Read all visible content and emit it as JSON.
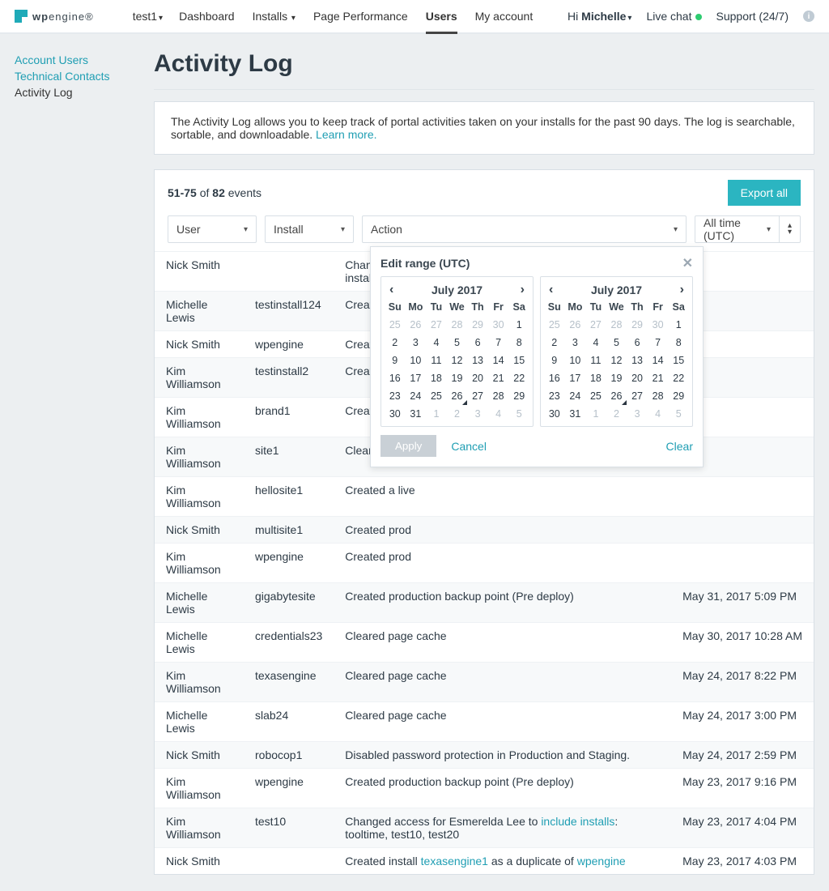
{
  "brand": {
    "name_strong": "wp",
    "name_light": "engine®"
  },
  "topnav": {
    "account": "test1",
    "items": [
      "Dashboard",
      "Installs",
      "Page Performance",
      "Users",
      "My account"
    ],
    "active_index": 3
  },
  "topright": {
    "hi_prefix": "Hi ",
    "user": "Michelle",
    "live_chat": "Live chat",
    "support": "Support (24/7)"
  },
  "sidebar": {
    "items": [
      "Account Users",
      "Technical Contacts",
      "Activity Log"
    ],
    "active_index": 2
  },
  "page": {
    "title": "Activity Log",
    "info_text": "The Activity Log allows you to keep track of portal activities taken on your installs for the past 90 days. The log is searchable, sortable, and downloadable. ",
    "learn_more": "Learn more."
  },
  "count": {
    "range": "51-75",
    "of_word": " of ",
    "total": "82",
    "tail": " events"
  },
  "export_label": "Export all",
  "filters": {
    "user": "User",
    "install": "Install",
    "action": "Action",
    "time": "All time (UTC)"
  },
  "popover": {
    "title": "Edit range (UTC)",
    "month": "July 2017",
    "dow": [
      "Su",
      "Mo",
      "Tu",
      "We",
      "Th",
      "Fr",
      "Sa"
    ],
    "cells": [
      {
        "n": 25,
        "m": true
      },
      {
        "n": 26,
        "m": true
      },
      {
        "n": 27,
        "m": true
      },
      {
        "n": 28,
        "m": true
      },
      {
        "n": 29,
        "m": true
      },
      {
        "n": 30,
        "m": true
      },
      {
        "n": 1
      },
      {
        "n": 2
      },
      {
        "n": 3
      },
      {
        "n": 4
      },
      {
        "n": 5
      },
      {
        "n": 6
      },
      {
        "n": 7
      },
      {
        "n": 8
      },
      {
        "n": 9
      },
      {
        "n": 10
      },
      {
        "n": 11
      },
      {
        "n": 12
      },
      {
        "n": 13
      },
      {
        "n": 14
      },
      {
        "n": 15
      },
      {
        "n": 16
      },
      {
        "n": 17
      },
      {
        "n": 18
      },
      {
        "n": 19
      },
      {
        "n": 20
      },
      {
        "n": 21
      },
      {
        "n": 22
      },
      {
        "n": 23
      },
      {
        "n": 24
      },
      {
        "n": 25
      },
      {
        "n": 26,
        "mark": true
      },
      {
        "n": 27
      },
      {
        "n": 28
      },
      {
        "n": 29
      },
      {
        "n": 30
      },
      {
        "n": 31
      },
      {
        "n": 1,
        "m": true
      },
      {
        "n": 2,
        "m": true
      },
      {
        "n": 3,
        "m": true
      },
      {
        "n": 4,
        "m": true
      },
      {
        "n": 5,
        "m": true
      }
    ],
    "apply": "Apply",
    "cancel": "Cancel",
    "clear": "Clear"
  },
  "rows": [
    {
      "user": "Nick Smith",
      "install": "",
      "action_pre": "Changed acc",
      "action_post": "install1, insta",
      "date": ""
    },
    {
      "user": "Michelle Lewis",
      "install": "testinstall124",
      "action": "Created insta",
      "date": ""
    },
    {
      "user": "Nick Smith",
      "install": "wpengine",
      "action": "Created prod",
      "date": ""
    },
    {
      "user": "Kim Williamson",
      "install": "testinstall2",
      "action": "Created a sta",
      "date": ""
    },
    {
      "user": "Kim Williamson",
      "install": "brand1",
      "action": "Created a sta",
      "date": ""
    },
    {
      "user": "Kim Williamson",
      "install": "site1",
      "action": "Cleared page",
      "date": ""
    },
    {
      "user": "Kim Williamson",
      "install": "hellosite1",
      "action": "Created a live",
      "date": ""
    },
    {
      "user": "Nick Smith",
      "install": "multisite1",
      "action": "Created prod",
      "date": ""
    },
    {
      "user": "Kim Williamson",
      "install": "wpengine",
      "action": "Created prod",
      "date": ""
    },
    {
      "user": "Michelle Lewis",
      "install": "gigabytesite",
      "action": "Created production backup point (Pre deploy)",
      "date": "May 31, 2017 5:09 PM"
    },
    {
      "user": "Michelle Lewis",
      "install": "credentials23",
      "action": "Cleared page cache",
      "date": "May 30, 2017 10:28 AM"
    },
    {
      "user": "Kim Williamson",
      "install": "texasengine",
      "action": "Cleared page cache",
      "date": "May 24, 2017 8:22 PM"
    },
    {
      "user": "Michelle Lewis",
      "install": "slab24",
      "action": "Cleared page cache",
      "date": "May 24, 2017 3:00 PM"
    },
    {
      "user": "Nick Smith",
      "install": "robocop1",
      "action": "Disabled password protection in Production and Staging.",
      "date": "May 24, 2017 2:59 PM"
    },
    {
      "user": "Kim Williamson",
      "install": "wpengine",
      "action": "Created production backup point (Pre deploy)",
      "date": "May 23, 2017 9:16 PM"
    },
    {
      "user": "Kim Williamson",
      "install": "test10",
      "action_html": "Changed access for Esmerelda Lee to <a>include installs</a>: tooltime, test10, test20",
      "date": "May 23, 2017 4:04 PM"
    },
    {
      "user": "Nick Smith",
      "install": "",
      "action_html": "Created install <a>texasengine1</a> as a duplicate of <a>wpengine</a>",
      "date": "May 23, 2017 4:03 PM"
    }
  ]
}
